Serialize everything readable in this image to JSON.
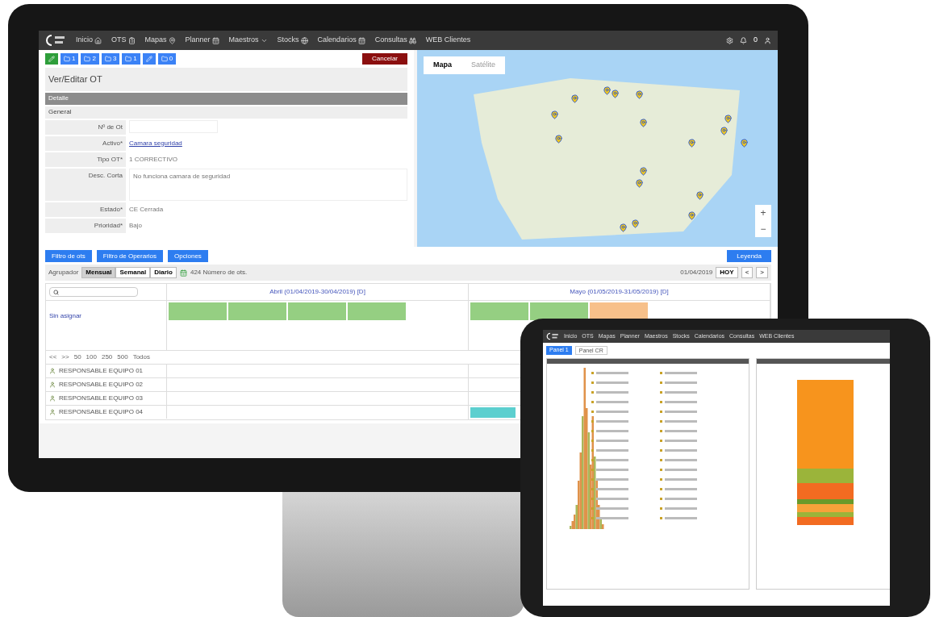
{
  "monitor": {
    "nav": {
      "items": [
        {
          "label": "Inicio",
          "kind": "home"
        },
        {
          "label": "OTS",
          "kind": "clipboard"
        },
        {
          "label": "Mapas",
          "kind": "pin"
        },
        {
          "label": "Planner",
          "kind": "calendar"
        },
        {
          "label": "Maestros",
          "kind": "caret"
        },
        {
          "label": "Stocks",
          "kind": "globe"
        },
        {
          "label": "Calendarios",
          "kind": "calendar"
        },
        {
          "label": "Consultas",
          "kind": "binoculars"
        },
        {
          "label": "WEB Clientes",
          "kind": "none"
        }
      ],
      "notifications": "0"
    },
    "toolbar": {
      "buttons": [
        {
          "kind": "edit"
        },
        {
          "kind": "count",
          "count": "1"
        },
        {
          "kind": "count",
          "count": "2"
        },
        {
          "kind": "count",
          "count": "3"
        },
        {
          "kind": "count",
          "count": "1"
        },
        {
          "kind": "icon"
        },
        {
          "kind": "count",
          "count": "0"
        }
      ],
      "cancel": "Cancelar"
    },
    "form": {
      "title": "Ver/Editar OT",
      "sections": [
        {
          "label": "Detalle",
          "kind": "header"
        },
        {
          "label": "General",
          "kind": "subheader"
        }
      ],
      "fields": [
        {
          "label": "Nº de Ot",
          "kind": "input"
        },
        {
          "label": "Activo*",
          "kind": "link",
          "value": "Camara seguridad"
        },
        {
          "label": "Tipo OT*",
          "kind": "text",
          "value": "1 CORRECTIVO"
        },
        {
          "label": "Desc. Corta",
          "kind": "textarea",
          "value": "No funciona camara de seguridad"
        },
        {
          "label": "Estado*",
          "kind": "text",
          "value": "CE Cerrada"
        },
        {
          "label": "Prioridad*",
          "kind": "text",
          "value": "Bajo"
        }
      ]
    },
    "map": {
      "tabs": [
        {
          "label": "Mapa",
          "selected": true
        },
        {
          "label": "Satélite",
          "selected": false
        }
      ],
      "zoom_in": "+",
      "zoom_out": "−"
    },
    "calendar": {
      "filters": [
        "Filtro de ots",
        "Filtro de Operarios",
        "Opciones"
      ],
      "legend": "Leyenda",
      "grouper": "Agrupador",
      "views": [
        {
          "label": "Mensual",
          "selected": true
        },
        {
          "label": "Semanal",
          "selected": false
        },
        {
          "label": "Diario",
          "selected": false
        }
      ],
      "count": "424 Número de ots.",
      "date": "01/04/2019",
      "today": "HOY",
      "prev": "<",
      "next": ">",
      "months": [
        "Abril (01/04/2019-30/04/2019) [D]",
        "Mayo (01/05/2019-31/05/2019) [D]"
      ],
      "unassigned": {
        "label": "Sin asignar",
        "cells": [
          {
            "events": [
              {
                "color": "#95cf82"
              },
              {
                "color": "#95cf82"
              },
              {
                "color": "#95cf82"
              },
              {
                "color": "#95cf82"
              }
            ]
          },
          {
            "events": [
              {
                "color": "#95cf82"
              },
              {
                "color": "#95cf82"
              },
              {
                "color": "#f7c08a"
              }
            ]
          }
        ]
      },
      "page_sizes": [
        "<<",
        ">>",
        "50",
        "100",
        "250",
        "500",
        "Todos"
      ],
      "rows": [
        {
          "label": "RESPONSABLE EQUIPO 01"
        },
        {
          "label": "RESPONSABLE EQUIPO 02"
        },
        {
          "label": "RESPONSABLE EQUIPO 03"
        },
        {
          "label": "RESPONSABLE EQUIPO 04",
          "cells": [
            {
              "kind": "empty"
            },
            {
              "kind": "events",
              "events": [
                {
                  "color": "#5ccfcf"
                }
              ]
            }
          ]
        }
      ]
    }
  },
  "tablet": {
    "nav": {
      "items": [
        {
          "label": "Inicio"
        },
        {
          "label": "OTS"
        },
        {
          "label": "Mapas"
        },
        {
          "label": "Planner"
        },
        {
          "label": "Maestros"
        },
        {
          "label": "Stocks"
        },
        {
          "label": "Calendarios"
        },
        {
          "label": "Consultas"
        },
        {
          "label": "WEB Clientes"
        }
      ]
    },
    "tabs": [
      {
        "label": "Panel 1",
        "selected": true
      },
      {
        "label": "Panel CR",
        "selected": false
      }
    ]
  }
}
